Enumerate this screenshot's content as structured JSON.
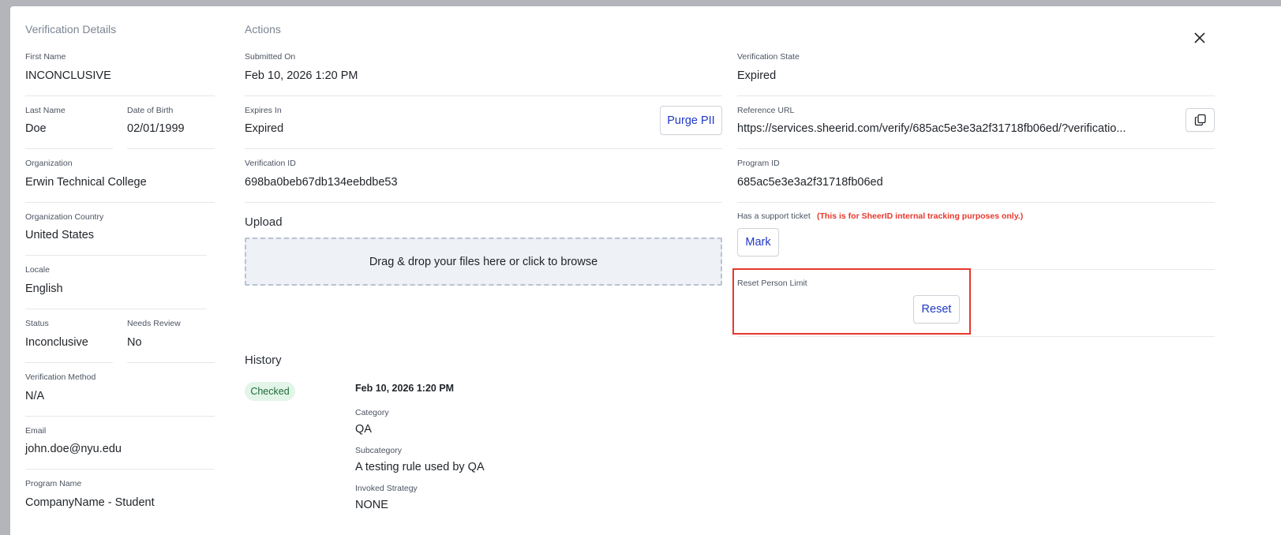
{
  "left": {
    "title": "Verification Details",
    "first_name": {
      "label": "First Name",
      "value": "INCONCLUSIVE"
    },
    "last_name": {
      "label": "Last Name",
      "value": "Doe"
    },
    "dob": {
      "label": "Date of Birth",
      "value": "02/01/1999"
    },
    "organization": {
      "label": "Organization",
      "value": "Erwin Technical College"
    },
    "org_country": {
      "label": "Organization Country",
      "value": "United States"
    },
    "locale": {
      "label": "Locale",
      "value": "English"
    },
    "status": {
      "label": "Status",
      "value": "Inconclusive"
    },
    "needs_review": {
      "label": "Needs Review",
      "value": "No"
    },
    "verification_method": {
      "label": "Verification Method",
      "value": "N/A"
    },
    "email": {
      "label": "Email",
      "value": "john.doe@nyu.edu"
    },
    "program_name": {
      "label": "Program Name",
      "value": "CompanyName - Student"
    }
  },
  "actions": {
    "title": "Actions",
    "submitted_on": {
      "label": "Submitted On",
      "value": "Feb 10, 2026 1:20 PM"
    },
    "expires_in": {
      "label": "Expires In",
      "value": "Expired"
    },
    "purge_label": "Purge PII",
    "verification_id": {
      "label": "Verification ID",
      "value": "698ba0beb67db134eebdbe53"
    },
    "upload_title": "Upload",
    "dropzone_text": "Drag & drop your files here or click to browse",
    "history_title": "History"
  },
  "right": {
    "verification_state": {
      "label": "Verification State",
      "value": "Expired"
    },
    "reference_url": {
      "label": "Reference URL",
      "value": "https://services.sheerid.com/verify/685ac5e3e3a2f31718fb06ed/?verificatio..."
    },
    "program_id": {
      "label": "Program ID",
      "value": "685ac5e3e3a2f31718fb06ed"
    },
    "support_ticket": {
      "label": "Has a support ticket",
      "note": "(This is for SheerID internal tracking purposes only.)",
      "button": "Mark"
    },
    "reset_limit": {
      "label": "Reset Person Limit",
      "button": "Reset"
    }
  },
  "history": {
    "badge": "Checked",
    "date": "Feb 10, 2026 1:20 PM",
    "category": {
      "label": "Category",
      "value": "QA"
    },
    "subcategory": {
      "label": "Subcategory",
      "value": "A testing rule used by QA"
    },
    "invoked_strategy": {
      "label": "Invoked Strategy",
      "value": "NONE"
    }
  },
  "colors": {
    "accent": "#2038c8",
    "highlight": "#e8382c",
    "badge_bg": "#e2f5e8",
    "badge_text": "#1f6b3a"
  },
  "icons": {
    "close": "close-icon",
    "copy": "copy-icon"
  }
}
